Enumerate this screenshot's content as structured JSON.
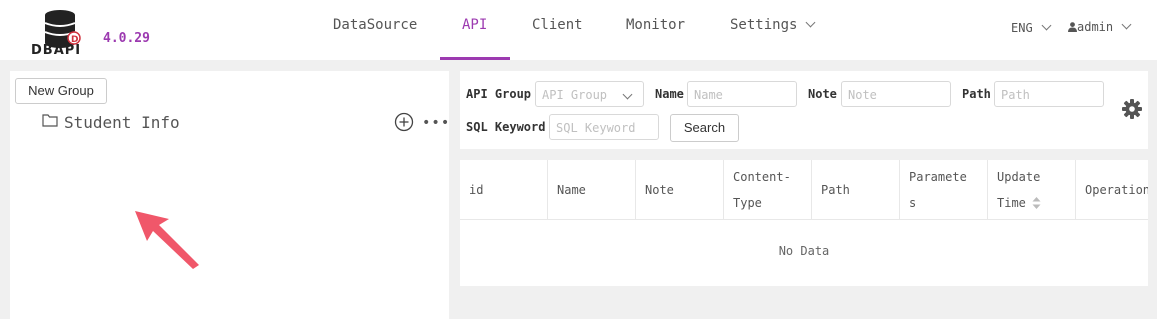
{
  "app": {
    "logo_text": "DBAPI",
    "version": "4.0.29"
  },
  "nav": {
    "items": [
      {
        "label": "DataSource",
        "active": false
      },
      {
        "label": "API",
        "active": true
      },
      {
        "label": "Client",
        "active": false
      },
      {
        "label": "Monitor",
        "active": false
      },
      {
        "label": "Settings",
        "active": false,
        "dropdown": true
      }
    ],
    "language": "ENG",
    "user": "admin"
  },
  "left": {
    "new_group_label": "New Group",
    "groups": [
      {
        "label": "Student Info",
        "icon": "folder-icon"
      }
    ],
    "more_label": "•••"
  },
  "filters": {
    "api_group": {
      "label": "API Group",
      "placeholder": "API Group"
    },
    "name": {
      "label": "Name",
      "placeholder": "Name"
    },
    "note": {
      "label": "Note",
      "placeholder": "Note"
    },
    "path": {
      "label": "Path",
      "placeholder": "Path"
    },
    "sql_keyword": {
      "label": "SQL Keyword",
      "placeholder": "SQL Keyword"
    },
    "search_label": "Search"
  },
  "table": {
    "columns": [
      {
        "line1": "id",
        "line2": ""
      },
      {
        "line1": "Name",
        "line2": ""
      },
      {
        "line1": "Note",
        "line2": ""
      },
      {
        "line1": "Content-",
        "line2": "Type"
      },
      {
        "line1": "Path",
        "line2": ""
      },
      {
        "line1": "Paramete",
        "line2": "s"
      },
      {
        "line1": "Update",
        "line2": "Time",
        "sortable": true
      },
      {
        "line1": "Operation",
        "line2": ""
      }
    ],
    "empty_text": "No Data"
  },
  "colors": {
    "accent": "#9c3ab0",
    "annotation_arrow": "#f0576a"
  }
}
